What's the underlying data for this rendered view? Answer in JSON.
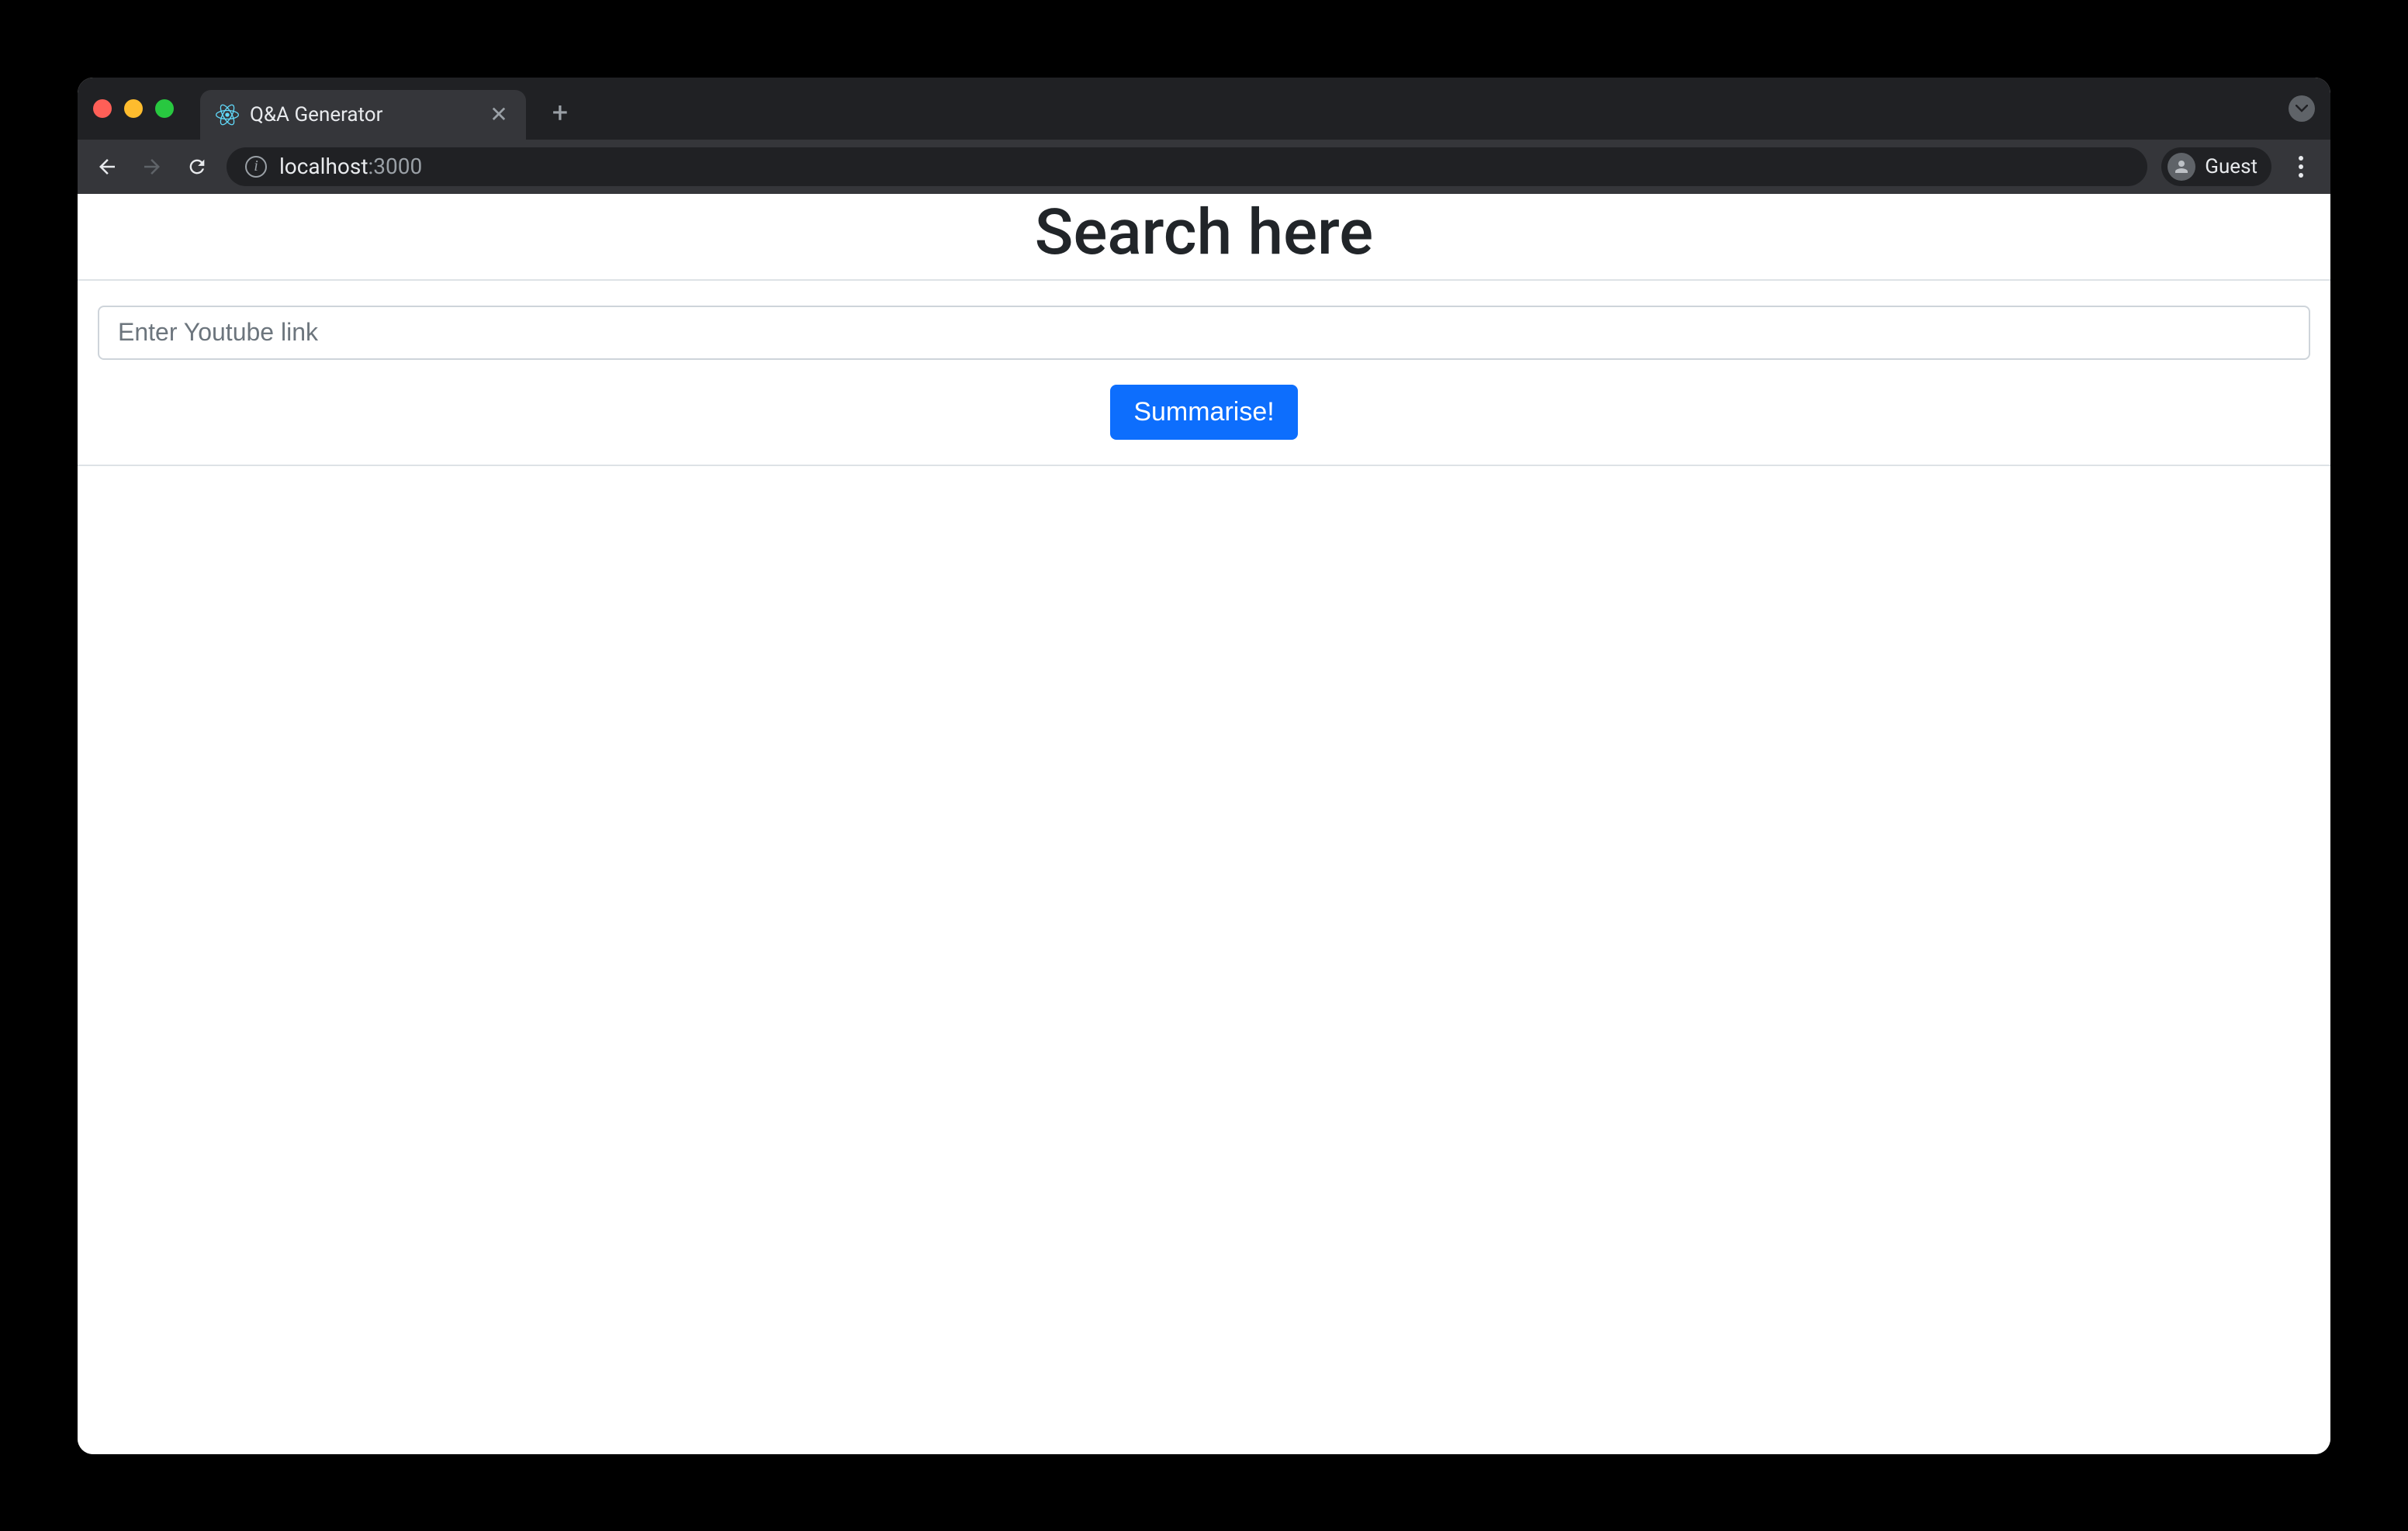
{
  "browser": {
    "tab": {
      "title": "Q&A Generator",
      "favicon": "react-logo"
    },
    "address": {
      "host": "localhost",
      "port": ":3000"
    },
    "profile": {
      "name": "Guest"
    }
  },
  "page": {
    "title": "Search here",
    "input": {
      "placeholder": "Enter Youtube link",
      "value": ""
    },
    "button": {
      "label": "Summarise!"
    }
  }
}
